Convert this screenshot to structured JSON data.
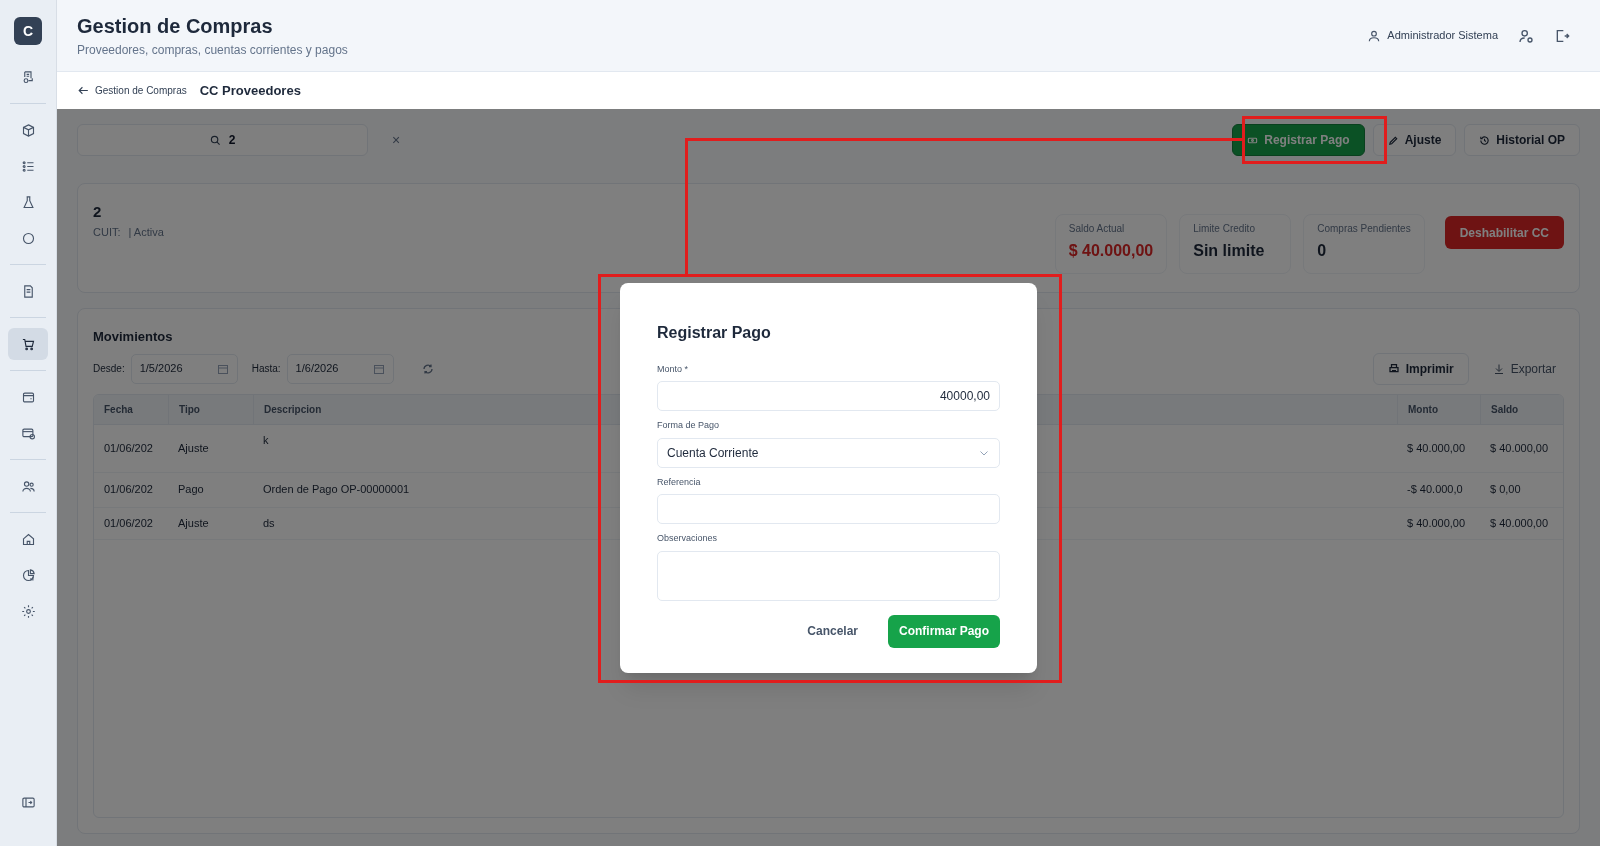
{
  "app": {
    "logo": "C"
  },
  "sidebar": {
    "groups": [
      [
        {
          "selected": false
        }
      ],
      [
        {
          "selected": false
        },
        {
          "selected": false
        },
        {
          "selected": false
        },
        {
          "selected": false
        }
      ],
      [
        {
          "selected": false
        }
      ],
      [
        {
          "selected": true
        }
      ],
      [
        {
          "selected": false
        },
        {
          "selected": false
        }
      ],
      [
        {
          "selected": false
        }
      ],
      [
        {
          "selected": false
        },
        {
          "selected": false
        },
        {
          "selected": false
        }
      ]
    ]
  },
  "header": {
    "title": "Gestion de Compras",
    "subtitle": "Proveedores, compras, cuentas corrientes y pagos",
    "user": "Administrador Sistema"
  },
  "breadcrumb": {
    "back": "Gestion de Compras",
    "current": "CC Proveedores"
  },
  "search": {
    "value": "2",
    "clear": "×"
  },
  "actions": [
    {
      "label": "Registrar Pago",
      "kind": "primary"
    },
    {
      "label": "Ajuste",
      "kind": "edit"
    },
    {
      "label": "Historial OP",
      "kind": "history"
    }
  ],
  "account": {
    "name": "2",
    "cuit_label": "CUIT:",
    "status": "| Activa",
    "stats": [
      {
        "label": "Saldo Actual",
        "value": "$ 40.000,00",
        "kind": "negative"
      },
      {
        "label": "Limite Credito",
        "value": "Sin limite",
        "kind": "normal"
      },
      {
        "label": "Compras Pendientes",
        "value": "0",
        "kind": "normal"
      }
    ],
    "disable_button": "Deshabilitar CC"
  },
  "movements": {
    "title": "Movimientos",
    "from_label": "Desde:",
    "from": "1/5/2026",
    "to_label": "Hasta:",
    "to": "1/6/2026",
    "print": "Imprimir",
    "export": "Exportar",
    "columns": [
      "Fecha",
      "Tipo",
      "Descripcion",
      "Monto",
      "Saldo"
    ],
    "rows": [
      [
        "01/06/202",
        "Ajuste",
        "k",
        "$ 40.000,00",
        "$ 40.000,00"
      ],
      [
        "01/06/202",
        "Pago",
        "Orden de Pago OP-00000001",
        "-$ 40.000,0",
        "$ 0,00"
      ],
      [
        "01/06/202",
        "Ajuste",
        "ds",
        "$ 40.000,00",
        "$ 40.000,00"
      ]
    ]
  },
  "dialog": {
    "title": "Registrar Pago",
    "fields": [
      {
        "label": "Monto *",
        "value": "40000,00",
        "kind": "number"
      },
      {
        "label": "Forma de Pago",
        "value": "Cuenta Corriente",
        "kind": "select"
      },
      {
        "label": "Referencia",
        "kind": "text"
      },
      {
        "label": "Observaciones",
        "kind": "textarea"
      }
    ],
    "cancel": "Cancelar",
    "confirm": "Confirmar Pago"
  }
}
